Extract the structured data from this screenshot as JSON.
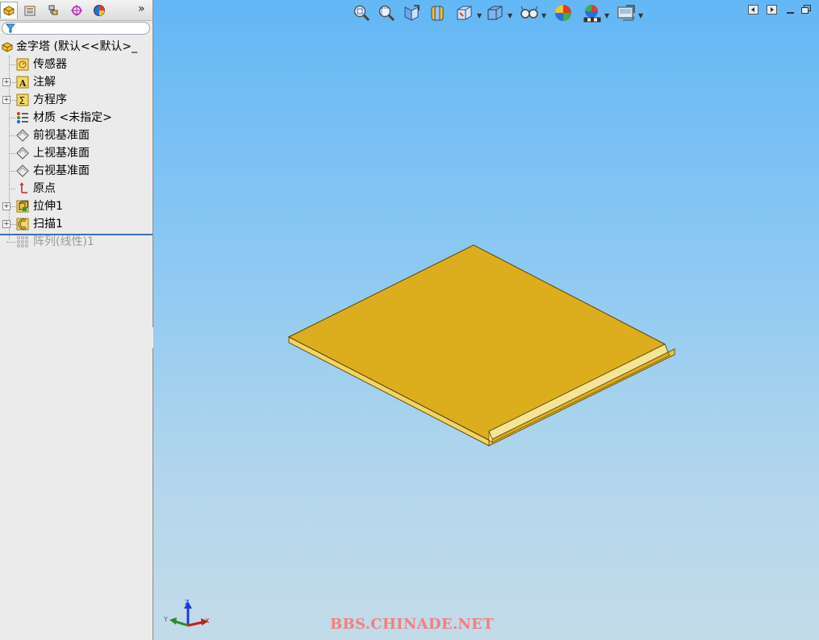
{
  "panel": {
    "tabs": [
      {
        "name": "feature-manager-tab",
        "active": true
      },
      {
        "name": "property-manager-tab",
        "active": false
      },
      {
        "name": "configuration-manager-tab",
        "active": false
      },
      {
        "name": "dimxpert-manager-tab",
        "active": false
      },
      {
        "name": "display-manager-tab",
        "active": false
      }
    ],
    "more_label": "»",
    "tree": {
      "root": "金字塔  (默认<<默认>_",
      "items": [
        {
          "label": "传感器",
          "icon": "sensor-icon",
          "expandable": false
        },
        {
          "label": "注解",
          "icon": "annotations-icon",
          "expandable": true
        },
        {
          "label": "方程序",
          "icon": "equations-icon",
          "expandable": true
        },
        {
          "label": "材质 <未指定>",
          "icon": "material-icon",
          "expandable": false
        },
        {
          "label": "前视基准面",
          "icon": "plane-icon",
          "expandable": false
        },
        {
          "label": "上视基准面",
          "icon": "plane-icon",
          "expandable": false
        },
        {
          "label": "右视基准面",
          "icon": "plane-icon",
          "expandable": false
        },
        {
          "label": "原点",
          "icon": "origin-icon",
          "expandable": false
        },
        {
          "label": "拉伸1",
          "icon": "extrude-icon",
          "expandable": true
        },
        {
          "label": "扫描1",
          "icon": "sweep-icon",
          "expandable": true
        },
        {
          "label": "阵列(线性)1",
          "icon": "linear-pattern-icon",
          "expandable": false,
          "suppressed": true
        }
      ]
    }
  },
  "viewport": {
    "watermark": "BBS.CHINADE.NET",
    "triad_labels": {
      "x": "X",
      "y": "Y",
      "z": "Z"
    },
    "hud_tools": [
      "zoom-to-fit-icon",
      "zoom-to-area-icon",
      "previous-view-icon",
      "section-view-icon",
      "view-orientation-icon",
      "display-style-icon",
      "hide-show-items-icon",
      "edit-appearance-icon",
      "apply-scene-icon",
      "view-settings-icon"
    ],
    "colors": {
      "part_top": "#dcae1e",
      "part_edge": "#7a5a00",
      "part_side": "#f1df7a",
      "background_top": "#63b7f5",
      "background_bottom": "#c3dbe9"
    }
  }
}
